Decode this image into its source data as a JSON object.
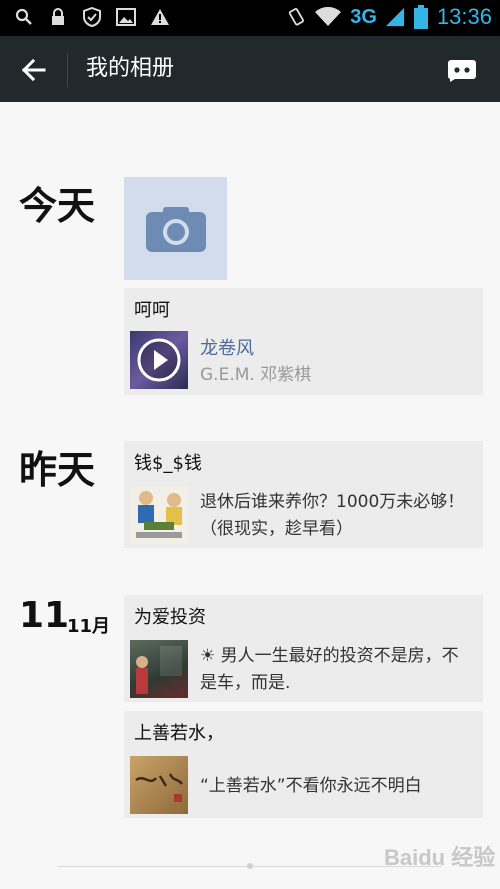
{
  "status_bar": {
    "network": "3G",
    "time": "13:36"
  },
  "header": {
    "title": "我的相册"
  },
  "timeline": [
    {
      "date": "今天",
      "posts": [
        {
          "title": "呵呵",
          "type": "music",
          "music_title": "龙卷风",
          "music_artist": "G.E.M. 邓紫棋"
        }
      ]
    },
    {
      "date": "昨天",
      "posts": [
        {
          "title": "钱$_$钱",
          "type": "link",
          "text": "退休后谁来养你？1000万未必够！（很现实，趁早看）"
        }
      ]
    },
    {
      "date_day": "11",
      "date_month": "11月",
      "posts": [
        {
          "title": "为爱投资",
          "type": "link",
          "text": "☀ 男人一生最好的投资不是房，不是车，而是."
        },
        {
          "title": "上善若水，",
          "type": "link",
          "text": "“上善若水”不看你永远不明白"
        }
      ]
    }
  ],
  "watermark": "Baidu 经验"
}
